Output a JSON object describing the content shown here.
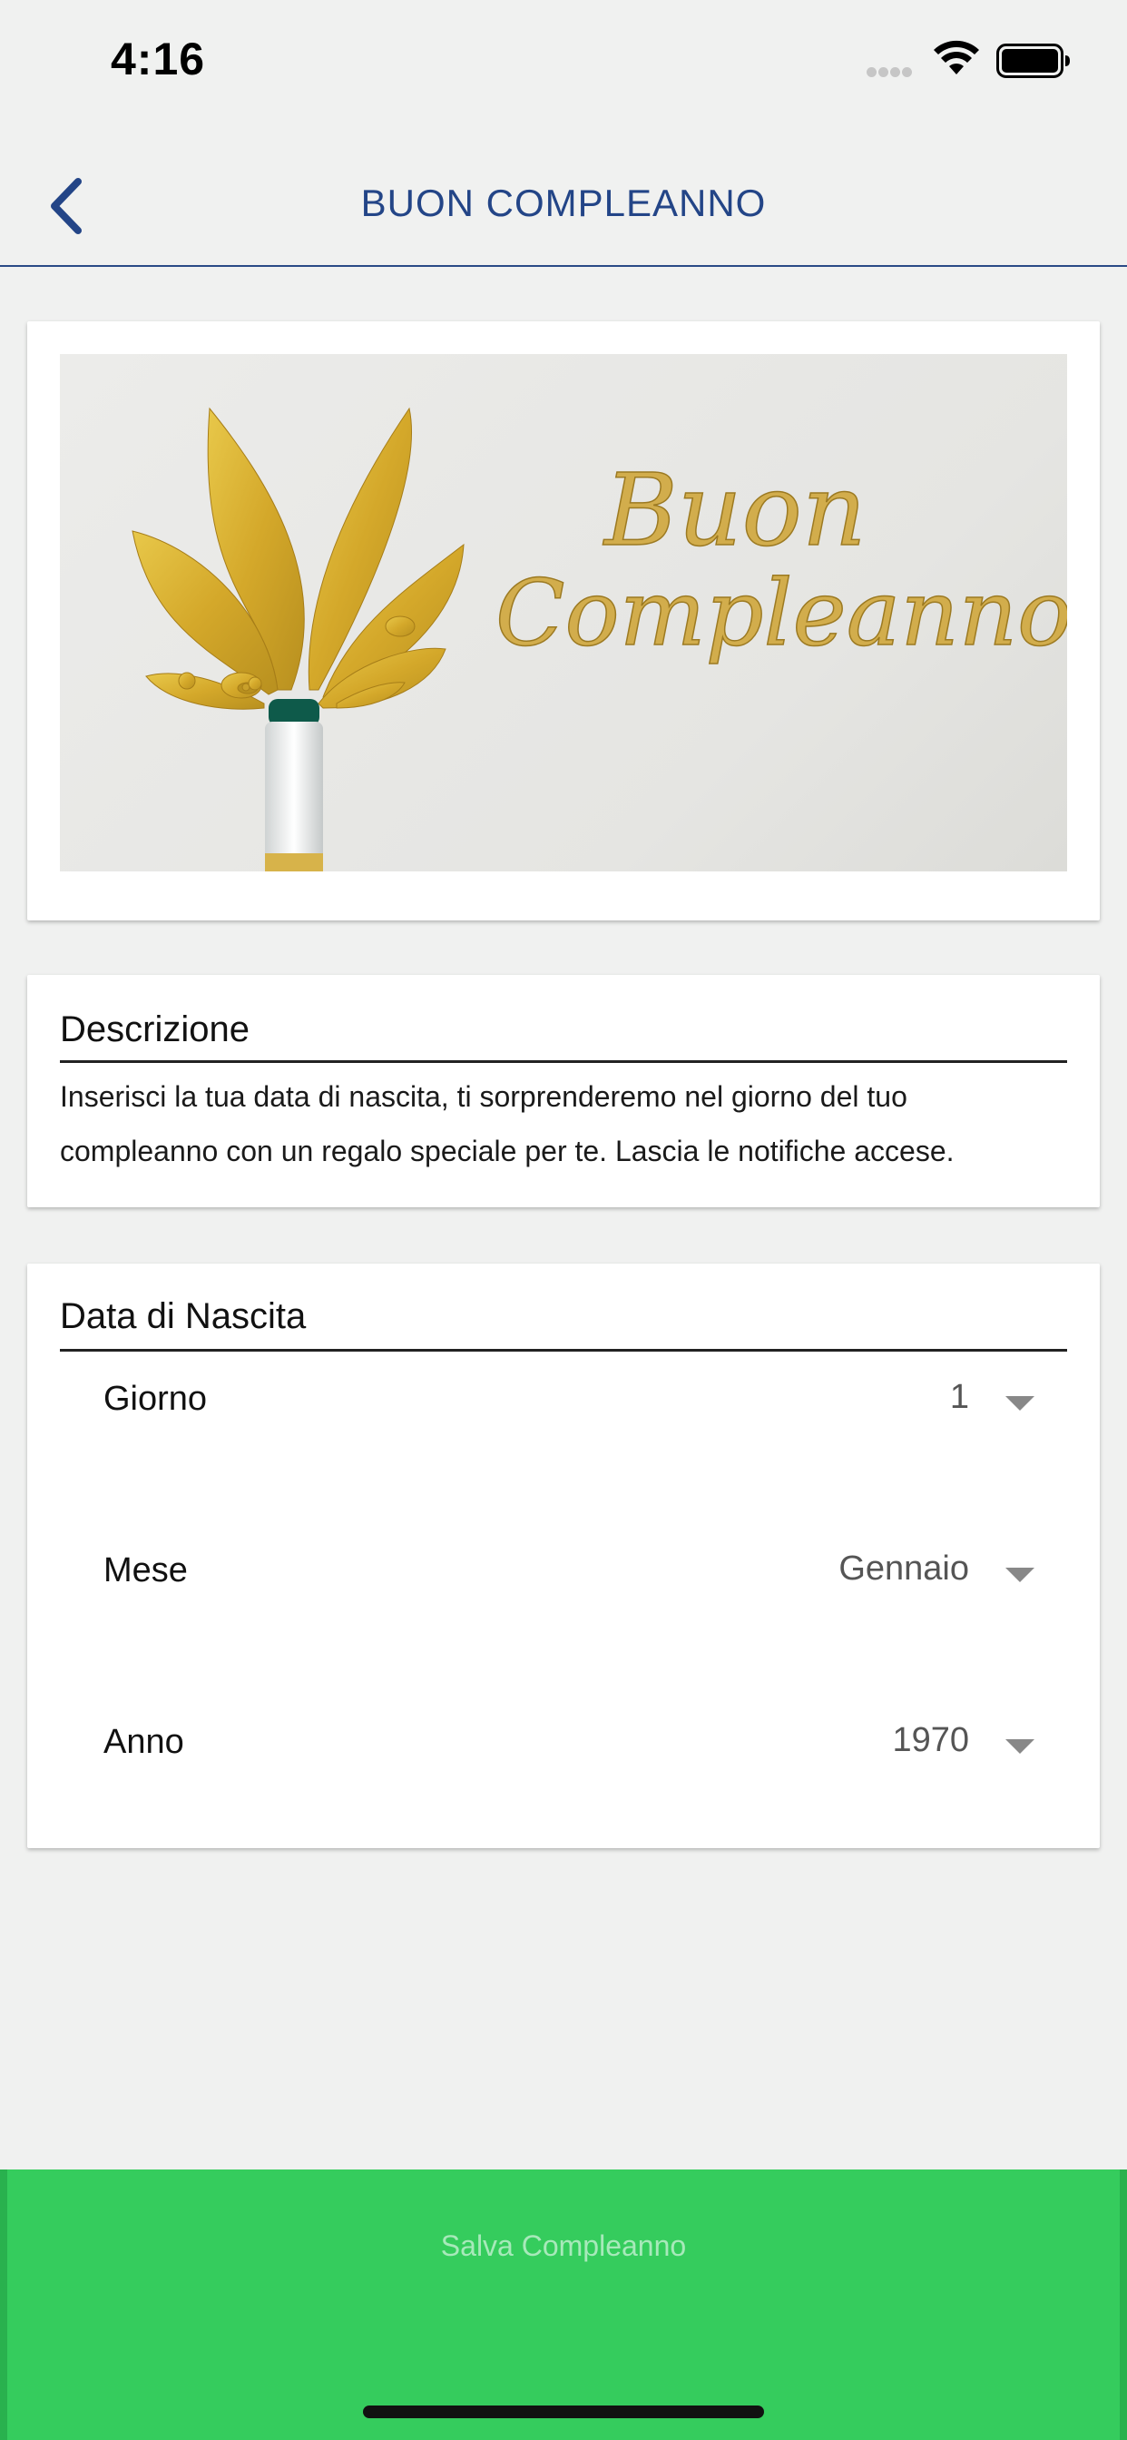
{
  "status": {
    "time": "4:16"
  },
  "header": {
    "title": "BUON COMPLEANNO"
  },
  "banner": {
    "script_line1": "Buon",
    "script_line2": "Compleanno"
  },
  "description": {
    "title": "Descrizione",
    "text": "Inserisci la tua data di nascita, ti sorprenderemo nel giorno del tuo compleanno con un regalo speciale per te. Lascia le notifiche accese."
  },
  "birth": {
    "title": "Data di Nascita",
    "day": {
      "label": "Giorno",
      "value": "1"
    },
    "month": {
      "label": "Mese",
      "value": "Gennaio"
    },
    "year": {
      "label": "Anno",
      "value": "1970"
    }
  },
  "footer": {
    "save_label": "Salva Compleanno"
  },
  "colors": {
    "accent": "#234587",
    "save_button": "#35cc5d",
    "background": "#f0f1f0"
  }
}
